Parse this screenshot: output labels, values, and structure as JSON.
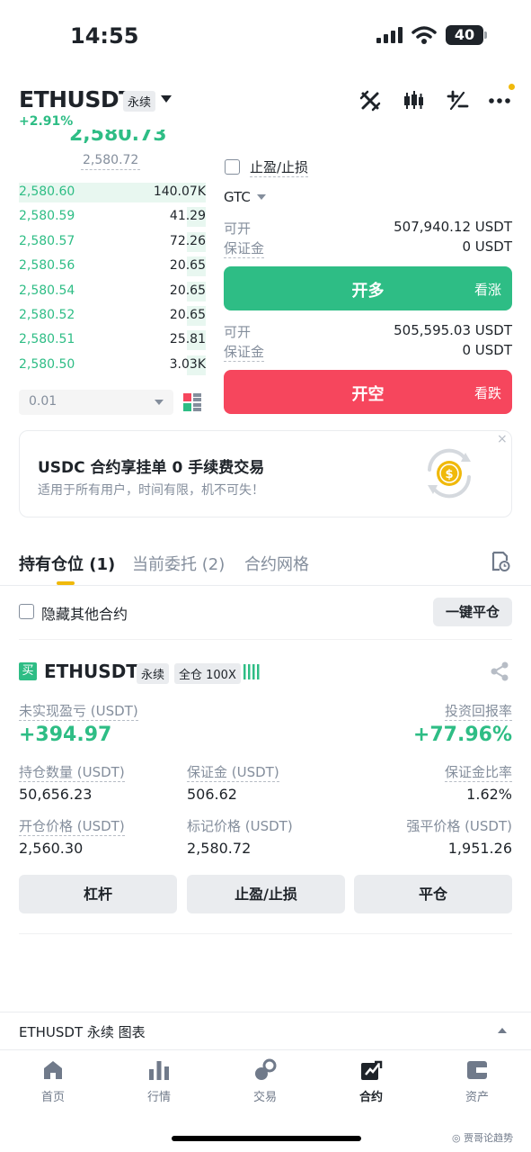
{
  "status_bar": {
    "time": "14:55",
    "battery": "40"
  },
  "header": {
    "symbol": "ETHUSDT",
    "contract_type": "永续",
    "change": "+2.91%",
    "icons": [
      "sword-icon",
      "candlestick-icon",
      "plus-minus-icon",
      "more-icon"
    ]
  },
  "orderbook": {
    "last_price": "2,580.73",
    "mark_price": "2,580.72",
    "bids": [
      {
        "price": "2,580.60",
        "qty": "140.07K",
        "depth": 1.0
      },
      {
        "price": "2,580.59",
        "qty": "41.29",
        "depth": 0.1
      },
      {
        "price": "2,580.57",
        "qty": "72.26",
        "depth": 0.1
      },
      {
        "price": "2,580.56",
        "qty": "20.65",
        "depth": 0.1
      },
      {
        "price": "2,580.54",
        "qty": "20.65",
        "depth": 0.1
      },
      {
        "price": "2,580.52",
        "qty": "20.65",
        "depth": 0.1
      },
      {
        "price": "2,580.51",
        "qty": "25.81",
        "depth": 0.1
      },
      {
        "price": "2,580.50",
        "qty": "3.03K",
        "depth": 0.1
      }
    ],
    "precision": "0.01"
  },
  "order_panel": {
    "tpsl_label": "止盈/止损",
    "time_in_force": "GTC",
    "long": {
      "available_label": "可开",
      "available": "507,940.12 USDT",
      "margin_label": "保证金",
      "margin": "0 USDT",
      "button": "开多",
      "hint": "看涨"
    },
    "short": {
      "available_label": "可开",
      "available": "505,595.03 USDT",
      "margin_label": "保证金",
      "margin": "0 USDT",
      "button": "开空",
      "hint": "看跌"
    }
  },
  "banner": {
    "title": "USDC 合约享挂单 0 手续费交易",
    "subtitle": "适用于所有用户，时间有限，机不可失！",
    "close": "×"
  },
  "tabs": [
    {
      "label": "持有仓位 (1)"
    },
    {
      "label": "当前委托 (2)"
    },
    {
      "label": "合约网格"
    }
  ],
  "filter": {
    "hide_others": "隐藏其他合约",
    "close_all": "一键平仓"
  },
  "position": {
    "side_badge": "买",
    "symbol": "ETHUSDT",
    "contract_type": "永续",
    "mode": "全仓 100X",
    "unrealized_pnl_label": "未实现盈亏 (USDT)",
    "unrealized_pnl": "+394.97",
    "roe_label": "投资回报率",
    "roe": "+77.96%",
    "size_label": "持仓数量 (USDT)",
    "size": "50,656.23",
    "margin_label": "保证金 (USDT)",
    "margin": "506.62",
    "margin_ratio_label": "保证金比率",
    "margin_ratio": "1.62%",
    "entry_label": "开仓价格 (USDT)",
    "entry": "2,560.30",
    "mark_label": "标记价格 (USDT)",
    "mark": "2,580.72",
    "liq_label": "强平价格 (USDT)",
    "liq": "1,951.26",
    "buttons": [
      "杠杆",
      "止盈/止损",
      "平仓"
    ]
  },
  "chart_bar": {
    "label": "ETHUSDT 永续  图表"
  },
  "bottom_nav": [
    {
      "label": "首页",
      "icon": "home-icon"
    },
    {
      "label": "行情",
      "icon": "markets-icon"
    },
    {
      "label": "交易",
      "icon": "trade-icon"
    },
    {
      "label": "合约",
      "icon": "futures-icon",
      "active": true
    },
    {
      "label": "资产",
      "icon": "wallet-icon"
    }
  ],
  "watermark": "◎ 贾哥论趋势",
  "colors": {
    "green": "#2ebd85",
    "red": "#f6465d",
    "accent": "#f0b90b"
  }
}
